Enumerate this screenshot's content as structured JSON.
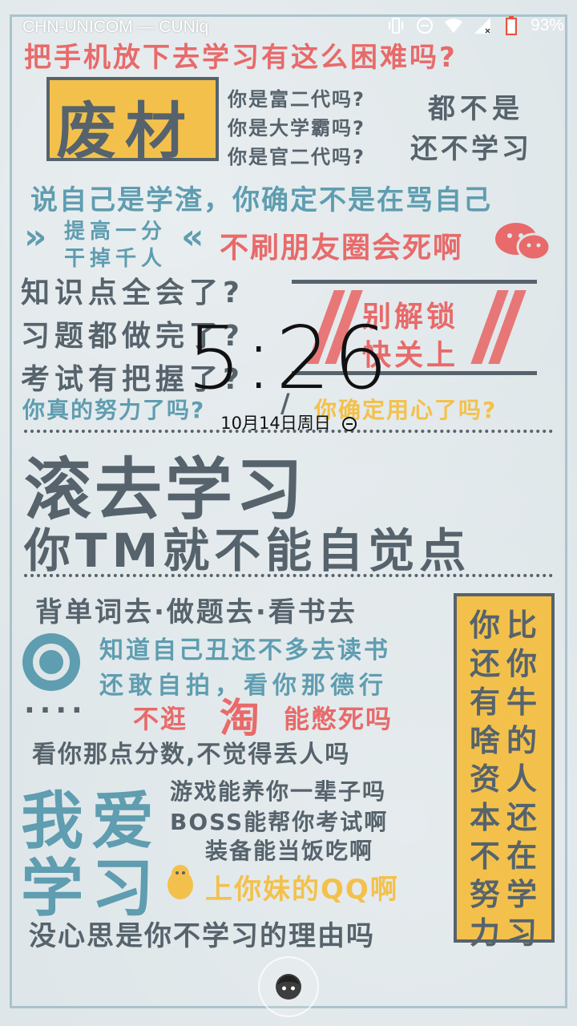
{
  "status_bar": {
    "carrier": "CHN-UNICOM — CUNiq",
    "battery": "93%",
    "icons": [
      "vibrate-icon",
      "dnd-icon",
      "wifi-icon",
      "signal-icon",
      "battery-icon"
    ]
  },
  "lockscreen": {
    "time": "5:26",
    "date": "10月14日周日",
    "unlock_icon": "face-icon"
  },
  "wallpaper": {
    "line1": "把手机放下去学习有这么困难吗?",
    "feicai": "废材",
    "questions": [
      "你是富二代吗?",
      "你是大学霸吗?",
      "你是官二代吗?"
    ],
    "answer1": "都不是",
    "answer2": "还不学习",
    "line_xuezha": "说自己是学渣，你确定不是在骂自己",
    "tigao1": "提高一分",
    "tigao2": "干掉千人",
    "pengyouquan": "不刷朋友圈会死啊",
    "zhishi": [
      "知识点全会了?",
      "习题都做完了?",
      "考试有把握了?"
    ],
    "bie_jiesuo": "别解锁",
    "kuai_guanshang": "快关上",
    "nuli": "你真的努力了吗?",
    "slash": "/",
    "yongxin": "你确定用心了吗?",
    "gunqu": "滚去学习",
    "zijue": "你TM就不能自觉点",
    "beidanci": "背单词去·做题去·看书去",
    "zhidao": "知道自己丑还不多去读书",
    "ganzipai": "还敢自拍，看你那德行",
    "dots": "····",
    "taobao_pre": "不逛",
    "taobao_tao": "淘",
    "taobao_post": "能憋死吗",
    "fenshu": "看你那点分数,不觉得丢人吗",
    "woai": "我爱",
    "xuexi": "学习",
    "youxi": "游戏能养你一辈子吗",
    "boss": "BOSS能帮你考试啊",
    "zhuangbei": "装备能当饭吃啊",
    "qq": "上你妹的QQ啊",
    "xinsi": "没心思是你不学习的理由吗",
    "right_col1": "你还有啥资本不努力",
    "right_col2": "比你牛的人还在学习"
  },
  "colors": {
    "red": "#e86a6a",
    "blue": "#5f9db0",
    "dark": "#56636c",
    "yellow": "#f3c14b"
  }
}
